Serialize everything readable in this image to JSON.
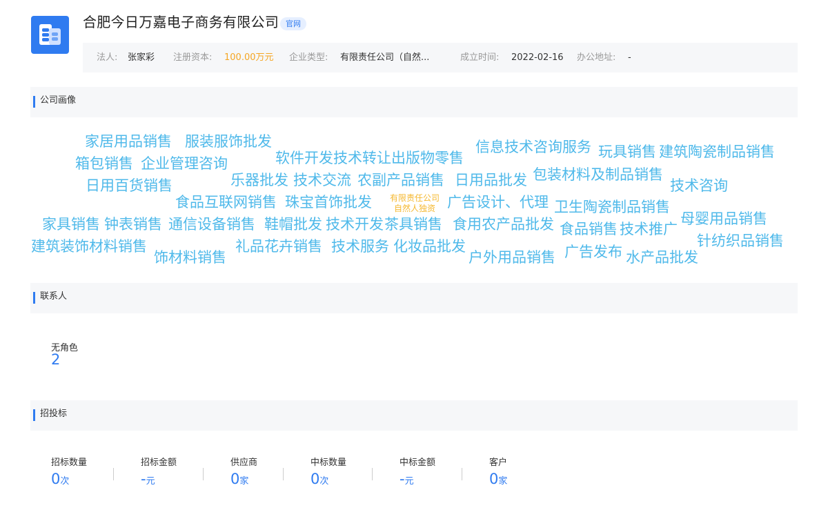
{
  "company": {
    "name": "合肥今日万嘉电子商务有限公司",
    "badge": "官网",
    "info": [
      {
        "label": "法人:",
        "value": "张家彩"
      },
      {
        "label": "注册资本:",
        "value": "100.00万元"
      },
      {
        "label": "企业类型:",
        "value": "有限责任公司（自然..."
      },
      {
        "label": "成立时间:",
        "value": "2022-02-16"
      },
      {
        "label": "办公地址:",
        "value": "-"
      }
    ]
  },
  "sections": {
    "portrait": "公司画像",
    "contacts": "联系人",
    "bids": "招投标"
  },
  "word_cloud": {
    "center_line1": "有限责任公司",
    "center_line2": "自然人独资",
    "words": [
      "家居用品销售",
      "服装服饰批发",
      "软件开发",
      "技术转让",
      "出版物零售",
      "信息技术咨询服务",
      "玩具销售",
      "建筑陶瓷制品销售",
      "箱包销售",
      "企业管理咨询",
      "日用百货销售",
      "乐器批发",
      "技术交流",
      "农副产品销售",
      "日用品批发",
      "包装材料及制品销售",
      "技术咨询",
      "食品互联网销售",
      "珠宝首饰批发",
      "广告设计、代理",
      "卫生陶瓷制品销售",
      "家具销售",
      "钟表销售",
      "通信设备销售",
      "鞋帽批发",
      "技术开发",
      "茶具销售",
      "食用农产品批发",
      "食品销售",
      "技术推广",
      "母婴用品销售",
      "建筑装饰材料销售",
      "饰材料销售",
      "礼品花卉销售",
      "技术服务",
      "化妆品批发",
      "户外用品销售",
      "广告发布",
      "水产品批发",
      "针纺织品销售"
    ]
  },
  "contacts": {
    "label": "无角色",
    "value": "2"
  },
  "bids": {
    "stats": [
      {
        "label": "招标数量",
        "value": "0",
        "unit": "次"
      },
      {
        "label": "招标金额",
        "value": "-",
        "unit": "元"
      },
      {
        "label": "供应商",
        "value": "0",
        "unit": "家"
      },
      {
        "label": "中标数量",
        "value": "0",
        "unit": "次"
      },
      {
        "label": "中标金额",
        "value": "-",
        "unit": "元"
      },
      {
        "label": "客户",
        "value": "0",
        "unit": "家"
      }
    ]
  }
}
